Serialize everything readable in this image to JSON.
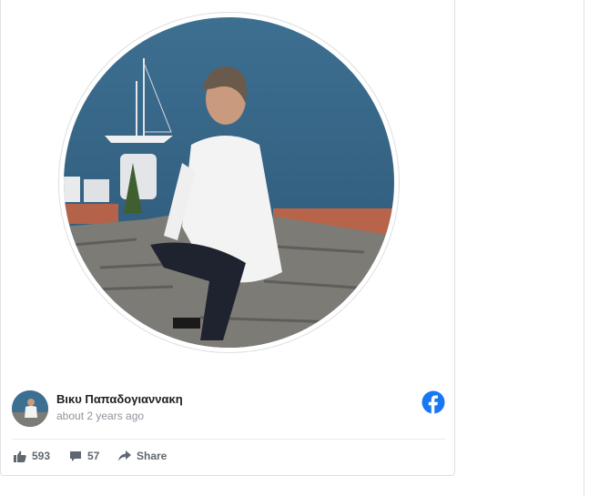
{
  "post": {
    "author_name": "Βικυ Παπαδογιαννακη",
    "time": "about 2 years ago",
    "photo_icon": "profile-photo",
    "platform_icon": "facebook-icon"
  },
  "actions": {
    "likes": "593",
    "comments": "57",
    "share_label": "Share"
  },
  "colors": {
    "facebook_blue": "#1877f2",
    "action_gray": "#606770",
    "border": "#dddfe2"
  }
}
